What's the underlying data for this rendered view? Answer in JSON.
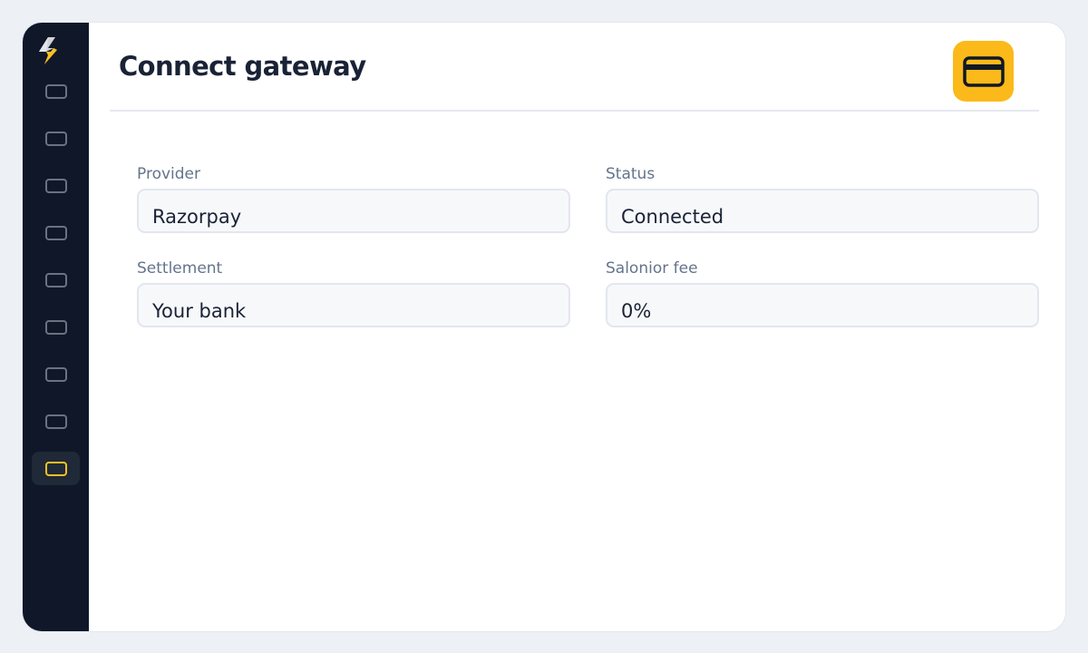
{
  "colors": {
    "accent": "#fbb91a",
    "sidebar_bg": "#0f1729",
    "title": "#1a2236",
    "label": "#64748b"
  },
  "sidebar": {
    "logo_icon": "lightning-bolt-icon",
    "items": [
      {
        "icon": "nav-icon",
        "active": false
      },
      {
        "icon": "nav-icon",
        "active": false
      },
      {
        "icon": "nav-icon",
        "active": false
      },
      {
        "icon": "nav-icon",
        "active": false
      },
      {
        "icon": "nav-icon",
        "active": false
      },
      {
        "icon": "nav-icon",
        "active": false
      },
      {
        "icon": "nav-icon",
        "active": false
      },
      {
        "icon": "nav-icon",
        "active": false
      },
      {
        "icon": "nav-icon",
        "active": true
      }
    ]
  },
  "header": {
    "title": "Connect gateway",
    "badge_icon": "credit-card-icon"
  },
  "fields": {
    "provider": {
      "label": "Provider",
      "value": "Razorpay"
    },
    "status": {
      "label": "Status",
      "value": "Connected"
    },
    "settlement": {
      "label": "Settlement",
      "value": "Your bank"
    },
    "fee": {
      "label": "Salonior fee",
      "value": "0%"
    }
  }
}
